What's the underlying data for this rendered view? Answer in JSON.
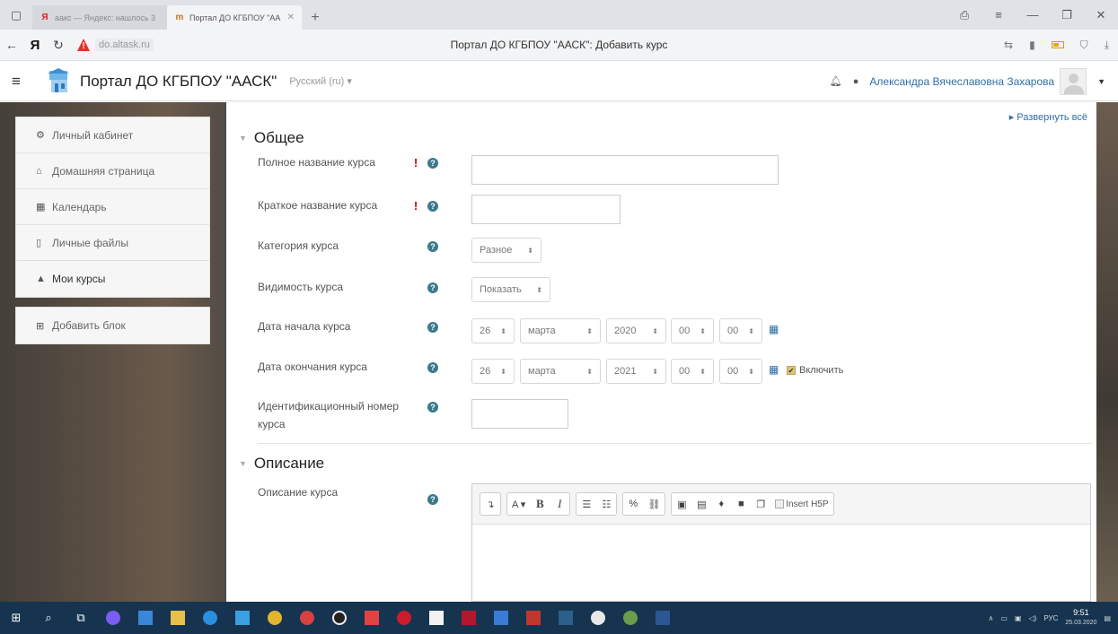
{
  "browser": {
    "tabs": [
      {
        "label": "аакс — Яндекс: нашлось 3",
        "active": false
      },
      {
        "label": "Портал ДО КГБПОУ \"АА",
        "active": true
      }
    ],
    "address": {
      "host": "do.altask.ru",
      "page_title": "Портал ДО КГБПОУ \"ААСК\": Добавить курс"
    }
  },
  "navbar": {
    "site_name": "Портал ДО КГБПОУ \"ААСК\"",
    "language": "Русский (ru) ▾",
    "user_name": "Александра Вячеславовна Захарова"
  },
  "sidebar": {
    "items": [
      {
        "label": "Личный кабинет",
        "icon": "dashboard-icon"
      },
      {
        "label": "Домашняя страница",
        "icon": "home-icon"
      },
      {
        "label": "Календарь",
        "icon": "calendar-icon"
      },
      {
        "label": "Личные файлы",
        "icon": "file-icon"
      },
      {
        "label": "Мои курсы",
        "icon": "graduation-cap-icon"
      }
    ],
    "add_block": "Добавить блок"
  },
  "main": {
    "expand_all": "▸ Развернуть всё",
    "section_general": "Общее",
    "fields": {
      "fullname": "Полное название курса",
      "shortname": "Краткое название курса",
      "category": "Категория курса",
      "visibility": "Видимость курса",
      "startdate": "Дата начала курса",
      "enddate": "Дата окончания курса",
      "idnumber": "Идентификационный номер курса"
    },
    "category_value": "Разное",
    "visibility_value": "Показать",
    "start": {
      "day": "26",
      "month": "марта",
      "year": "2020",
      "hour": "00",
      "minute": "00"
    },
    "end": {
      "day": "26",
      "month": "марта",
      "year": "2021",
      "hour": "00",
      "minute": "00"
    },
    "enable_label": "Включить",
    "section_description": "Описание",
    "description_label": "Описание курса",
    "editor": {
      "font_btn": "A ▾",
      "bold": "B",
      "italic": "I",
      "h5p": "Insert H5P"
    }
  },
  "taskbar": {
    "lang": "РУС",
    "time": "9:51",
    "date": "25.03.2020"
  },
  "colors": {
    "link": "#2f6fa7",
    "required": "#c5000d",
    "help": "#3b7a8c",
    "taskbar": "#16344f"
  }
}
